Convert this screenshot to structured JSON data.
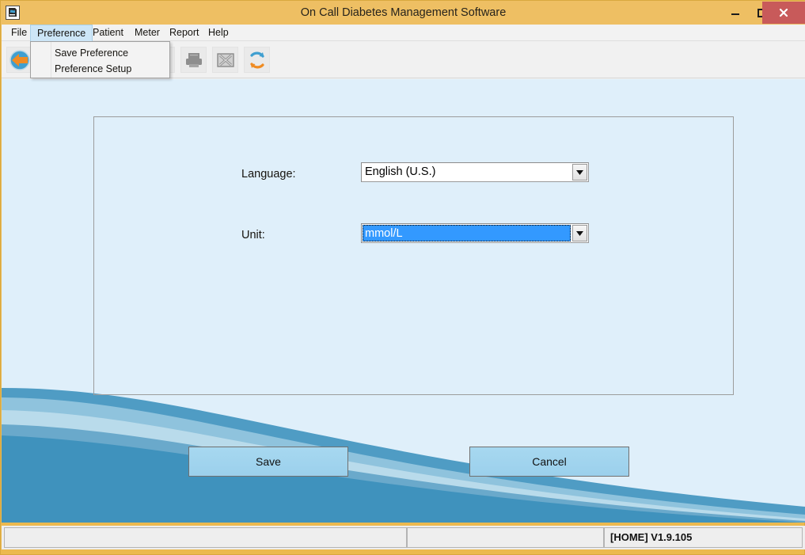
{
  "window": {
    "title": "On Call Diabetes Management Software",
    "icon": "app-icon",
    "controls": {
      "minimize": "minimize-icon",
      "maximize": "maximize-icon",
      "close": "close-icon"
    }
  },
  "menubar": {
    "items": [
      {
        "label": "File",
        "active": false
      },
      {
        "label": "Preference",
        "active": true
      },
      {
        "label": "Patient",
        "active": false
      },
      {
        "label": "Meter",
        "active": false
      },
      {
        "label": "Report",
        "active": false
      },
      {
        "label": "Help",
        "active": false
      }
    ]
  },
  "dropdown": {
    "open_for": "Preference",
    "items": [
      {
        "label": "Save Preference"
      },
      {
        "label": "Preference Setup"
      }
    ]
  },
  "toolbar": {
    "buttons": [
      {
        "icon": "back-arrow-icon",
        "enabled": true
      },
      {
        "icon": "report-document-icon",
        "enabled": true
      },
      {
        "icon": "printer-icon",
        "enabled": false
      },
      {
        "icon": "excel-export-icon",
        "enabled": false
      },
      {
        "icon": "refresh-icon",
        "enabled": true
      }
    ]
  },
  "form": {
    "language": {
      "label": "Language:",
      "value": "English (U.S.)",
      "selected": false
    },
    "unit": {
      "label": "Unit:",
      "value": "mmol/L",
      "selected": true
    }
  },
  "actions": {
    "save": "Save",
    "cancel": "Cancel"
  },
  "statusbar": {
    "left": "",
    "middle": "",
    "version": "[HOME] V1.9.105"
  },
  "colors": {
    "window_frame": "#ecb94f",
    "titlebar": "#eebf63",
    "close_button": "#c85a5a",
    "client_background": "#dfeffa",
    "wave_primary": "#3f92bd",
    "wave_secondary": "#6fb4d6",
    "selection_blue": "#3399ff",
    "button_blue": "#a7d8f0",
    "menu_active": "#cde6f7"
  }
}
